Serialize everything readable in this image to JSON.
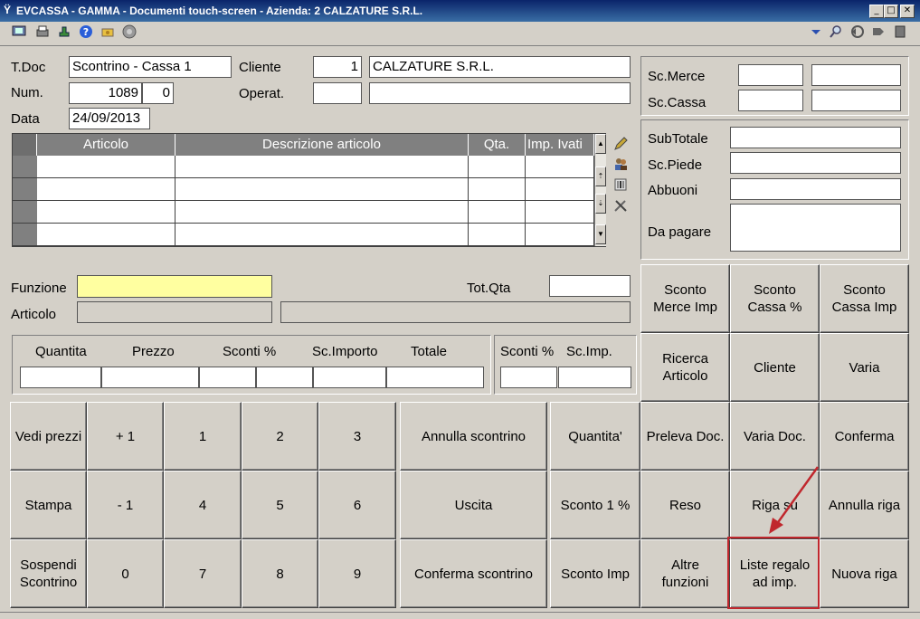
{
  "window": {
    "title": "EVCASSA - GAMMA - Documenti touch-screen - Azienda:    2 CALZATURE S.R.L.",
    "minimize": "_",
    "maximize": "□",
    "close": "✕"
  },
  "toolbar": {
    "left_icons": [
      "screen-icon",
      "print-icon",
      "export-icon",
      "help-icon",
      "cash-icon",
      "options-icon"
    ],
    "right_icons": [
      "dropdown-icon",
      "search-icon",
      "back-icon",
      "forward-icon",
      "exit-icon"
    ]
  },
  "header": {
    "tdoc_label": "T.Doc",
    "tdoc_value": "Scontrino - Cassa  1",
    "num_label": "Num.",
    "num_value": "1089",
    "num_suffix": "0",
    "data_label": "Data",
    "data_value": "24/09/2013",
    "cliente_label": "Cliente",
    "cliente_code": "1",
    "cliente_name": "CALZATURE S.R.L.",
    "operat_label": "Operat.",
    "operat_code": "",
    "operat_name": ""
  },
  "discounts": {
    "sc_merce_label": "Sc.Merce",
    "sc_cassa_label": "Sc.Cassa"
  },
  "totals": {
    "subtotale_label": "SubTotale",
    "sc_piede_label": "Sc.Piede",
    "abbuoni_label": "Abbuoni",
    "da_pagare_label": "Da pagare"
  },
  "grid": {
    "columns": [
      "Articolo",
      "Descrizione articolo",
      "Qta.",
      "Imp. Ivati"
    ],
    "rows": 4
  },
  "entry": {
    "funzione_label": "Funzione",
    "funzione_value": "",
    "articolo_label": "Articolo",
    "tot_qta_label": "Tot.Qta",
    "tot_qta_value": ""
  },
  "line_headers": {
    "quantita": "Quantita",
    "prezzo": "Prezzo",
    "sconti_pct": "Sconti %",
    "sc_importo": "Sc.Importo",
    "totale": "Totale",
    "sconti_pct2": "Sconti %",
    "sc_imp": "Sc.Imp."
  },
  "buttons": {
    "sconto_merce_imp": "Sconto\nMerce Imp",
    "sconto_cassa_pct": "Sconto\nCassa %",
    "sconto_cassa_imp": "Sconto\nCassa Imp",
    "ricerca_articolo": "Ricerca\nArticolo",
    "cliente": "Cliente",
    "varia": "Varia",
    "vedi_prezzi": "Vedi prezzi",
    "plus_one": "+ 1",
    "n1": "1",
    "n2": "2",
    "n3": "3",
    "annulla_scontrino": "Annulla scontrino",
    "quantita": "Quantita'",
    "preleva_doc": "Preleva Doc.",
    "varia_doc": "Varia Doc.",
    "conferma": "Conferma",
    "stampa": "Stampa",
    "minus_one": "- 1",
    "n4": "4",
    "n5": "5",
    "n6": "6",
    "uscita": "Uscita",
    "sconto_1_pct": "Sconto 1 %",
    "reso": "Reso",
    "riga_su": "Riga su",
    "annulla_riga": "Annulla riga",
    "sospendi_scontrino": "Sospendi\nScontrino",
    "n0": "0",
    "n7": "7",
    "n8": "8",
    "n9": "9",
    "conferma_scontrino": "Conferma scontrino",
    "sconto_imp": "Sconto Imp",
    "altre_funzioni": "Altre\nfunzioni",
    "liste_regalo": "Liste regalo\nad imp.",
    "nuova_riga": "Nuova riga"
  },
  "annotation": {
    "color": "#c0272d"
  }
}
